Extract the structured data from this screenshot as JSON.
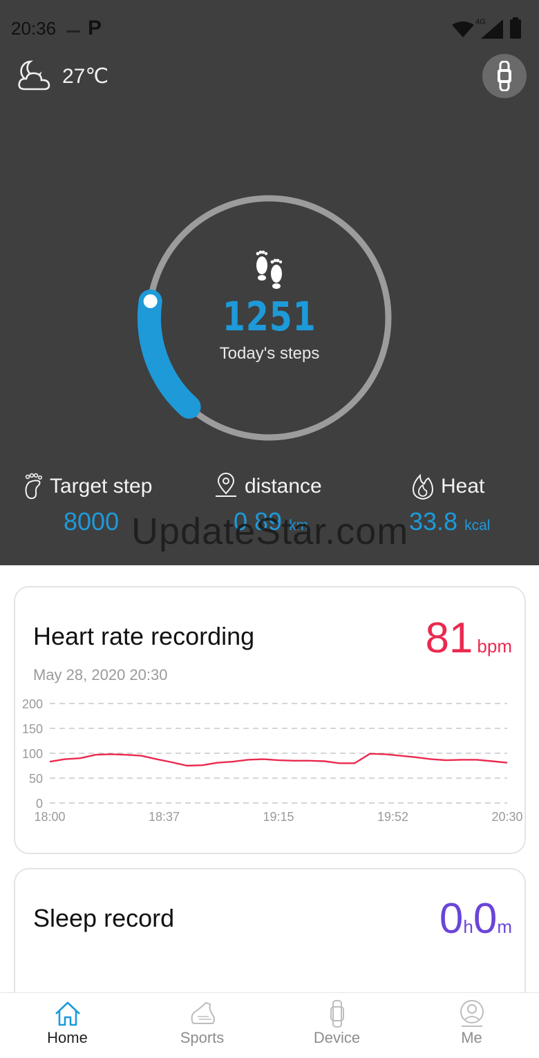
{
  "status_bar": {
    "time": "20:36",
    "network": "4G"
  },
  "weather": {
    "temperature": "27℃",
    "icon": "partly-cloudy-night-icon"
  },
  "device_button": {
    "icon": "band-icon"
  },
  "steps": {
    "value": "1251",
    "label": "Today's steps",
    "progress": 0.156,
    "icon": "footprints-icon"
  },
  "stats": {
    "target": {
      "label": "Target step",
      "value": "8000",
      "icon": "foot-icon"
    },
    "distance": {
      "label": "distance",
      "value": "0.89",
      "unit": "km",
      "icon": "location-pin-icon"
    },
    "heat": {
      "label": "Heat",
      "value": "33.8",
      "unit": "kcal",
      "icon": "flame-icon"
    }
  },
  "watermark": "UpdateStar.com",
  "heart_rate": {
    "title": "Heart rate recording",
    "value": "81",
    "unit": "bpm",
    "date": "May 28, 2020 20:30",
    "colors": {
      "line": "#ea2a4f"
    }
  },
  "chart_data": {
    "type": "line",
    "x_tick_labels": [
      "18:00",
      "18:37",
      "19:15",
      "19:52",
      "20:30"
    ],
    "y_tick_labels": [
      "200",
      "150",
      "100",
      "50",
      "0"
    ],
    "ylim": [
      0,
      200
    ],
    "xlim": [
      0,
      150
    ],
    "grid": true,
    "series": [
      {
        "x": [
          0,
          5,
          10,
          15,
          20,
          25,
          30,
          35,
          40,
          45,
          50,
          55,
          60,
          65,
          70,
          75,
          80,
          85,
          90,
          95,
          100,
          105,
          110,
          115,
          120,
          125,
          130,
          135,
          140,
          145,
          150
        ],
        "values": [
          83,
          88,
          90,
          97,
          98,
          97,
          95,
          88,
          82,
          75,
          76,
          81,
          83,
          87,
          88,
          86,
          85,
          85,
          84,
          80,
          80,
          99,
          98,
          95,
          92,
          88,
          86,
          87,
          87,
          84,
          81
        ]
      }
    ]
  },
  "sleep": {
    "title": "Sleep record",
    "hours": "0",
    "hours_unit": "h",
    "minutes": "0",
    "minutes_unit": "m"
  },
  "tabs": [
    {
      "label": "Home",
      "icon": "home-icon",
      "active": true
    },
    {
      "label": "Sports",
      "icon": "shoe-icon",
      "active": false
    },
    {
      "label": "Device",
      "icon": "watch-icon",
      "active": false
    },
    {
      "label": "Me",
      "icon": "person-icon",
      "active": false
    }
  ],
  "colors": {
    "accent": "#1e9ad9",
    "heart": "#ea2a4f",
    "sleep": "#6a45d8",
    "dark_bg": "#3f3f40"
  }
}
